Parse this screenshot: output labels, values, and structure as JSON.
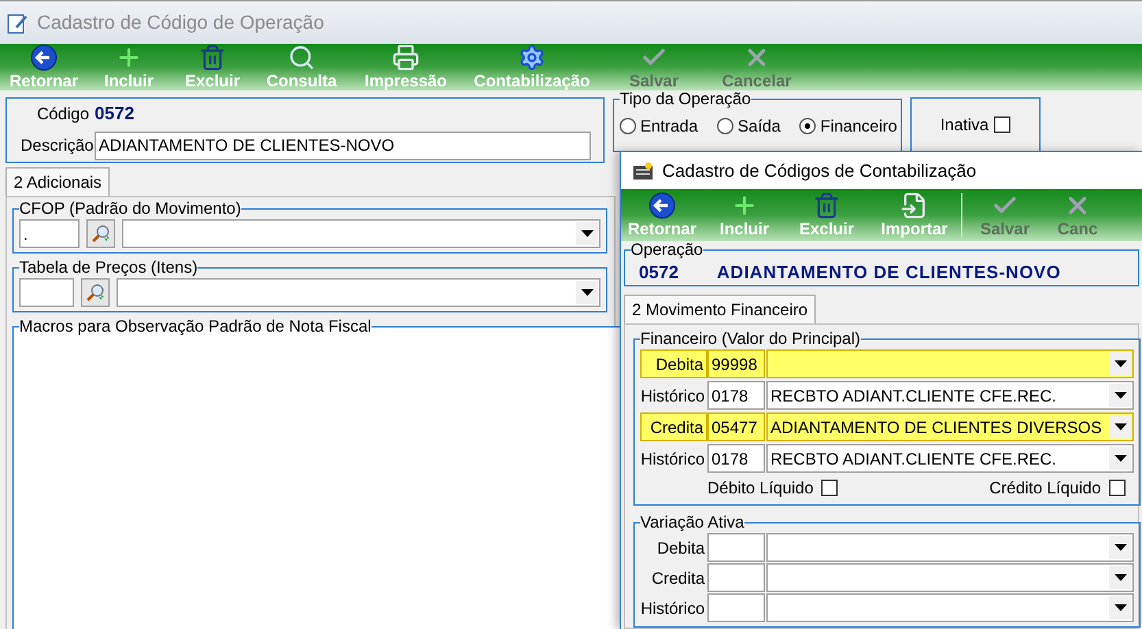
{
  "window": {
    "title": "Cadastro de Código de Operação"
  },
  "toolbar": [
    {
      "label": "Retornar",
      "disabled": false
    },
    {
      "label": "Incluir",
      "disabled": false
    },
    {
      "label": "Excluir",
      "disabled": false
    },
    {
      "label": "Consulta",
      "disabled": false
    },
    {
      "label": "Impressão",
      "disabled": false
    },
    {
      "label": "Contabilização",
      "disabled": false
    },
    {
      "label": "Salvar",
      "disabled": true
    },
    {
      "label": "Cancelar",
      "disabled": true
    }
  ],
  "header": {
    "codigo_label": "Código",
    "codigo": "0572",
    "descricao_label": "Descrição",
    "descricao": "ADIANTAMENTO DE CLIENTES-NOVO"
  },
  "tipo_operacao": {
    "title": "Tipo da Operação",
    "options": [
      {
        "label": "Entrada",
        "selected": false
      },
      {
        "label": "Saída",
        "selected": false
      },
      {
        "label": "Financeiro",
        "selected": true
      }
    ]
  },
  "inativa": {
    "label": "Inativa",
    "checked": false
  },
  "tabs": [
    {
      "label": "2 Adicionais",
      "selected": true
    }
  ],
  "cfop": {
    "title": "CFOP (Padrão do Movimento)",
    "code": "."
  },
  "tabela_precos": {
    "title": "Tabela de Preços (Itens)"
  },
  "macros": {
    "title": "Macros para Observação Padrão de Nota Fiscal"
  },
  "dialog": {
    "title": "Cadastro de Códigos de Contabilização",
    "toolbar": [
      {
        "kind": "button",
        "label": "Retornar",
        "disabled": false
      },
      {
        "kind": "button",
        "label": "Incluir",
        "disabled": false
      },
      {
        "kind": "button",
        "label": "Excluir",
        "disabled": false
      },
      {
        "kind": "button",
        "label": "Importar",
        "disabled": false
      },
      {
        "kind": "separator"
      },
      {
        "kind": "button",
        "label": "Salvar",
        "disabled": true
      },
      {
        "kind": "button",
        "label": "Canc",
        "disabled": true
      }
    ],
    "operacao": {
      "title": "Operação",
      "code": "0572",
      "name": "ADIANTAMENTO DE CLIENTES-NOVO"
    },
    "tabs": [
      {
        "label": "2 Movimento Financeiro",
        "selected": true
      }
    ],
    "financeiro": {
      "title": "Financeiro (Valor do Principal)",
      "rows": [
        {
          "label": "Debita",
          "code": "99998",
          "highlighted": true
        },
        {
          "label": "Histórico",
          "code": "0178",
          "value": "RECBTO ADIANT.CLIENTE CFE.REC.",
          "highlighted": false
        },
        {
          "label": "Credita",
          "code": "05477",
          "value": "ADIANTAMENTO DE CLIENTES DIVERSOS",
          "highlighted": true
        },
        {
          "label": "Histórico",
          "code": "0178",
          "value": "RECBTO ADIANT.CLIENTE CFE.REC.",
          "highlighted": false
        }
      ],
      "checks": [
        {
          "label": "Débito Líquido",
          "checked": false
        },
        {
          "label": "Crédito Líquido",
          "checked": false
        }
      ]
    },
    "variacao_ativa": {
      "title": "Variação Ativa",
      "rows": [
        {
          "label": "Debita",
          "highlighted": false
        },
        {
          "label": "Credita",
          "highlighted": false
        },
        {
          "label": "Histórico",
          "highlighted": false
        }
      ]
    }
  }
}
